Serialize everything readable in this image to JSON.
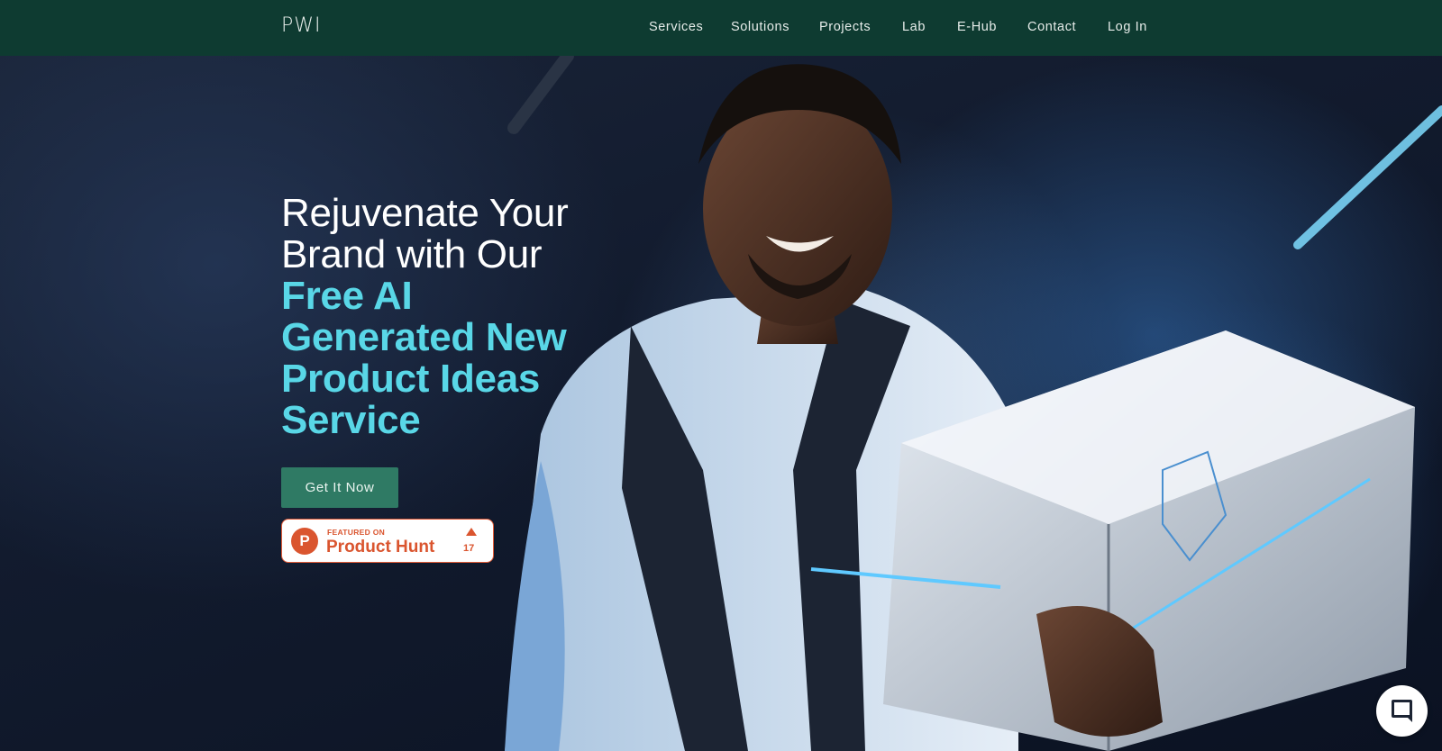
{
  "brand": {
    "logo_text": "PWI"
  },
  "nav": {
    "items": [
      {
        "label": "Services"
      },
      {
        "label": "Solutions"
      },
      {
        "label": "Projects"
      },
      {
        "label": "Lab"
      },
      {
        "label": "E-Hub"
      },
      {
        "label": "Contact"
      },
      {
        "label": "Log In"
      }
    ]
  },
  "hero": {
    "headline_line1": "Rejuvenate Your",
    "headline_line2": "Brand with Our",
    "headline_accent1": "Free AI",
    "headline_accent2": "Generated New",
    "headline_accent3": "Product Ideas",
    "headline_accent4": "Service",
    "cta_label": "Get It Now",
    "image_icon": "man-holding-futuristic-product-illustration"
  },
  "product_hunt_badge": {
    "small_text": "FEATURED ON",
    "name": "Product Hunt",
    "logo_letter": "P",
    "upvote_count": "17"
  },
  "chat_widget": {
    "icon": "chat-bubble-icon"
  },
  "colors": {
    "header_bg": "#0e3b31",
    "accent_text": "#59d7e7",
    "cta_bg": "#2f7a64",
    "product_hunt": "#da552f"
  }
}
